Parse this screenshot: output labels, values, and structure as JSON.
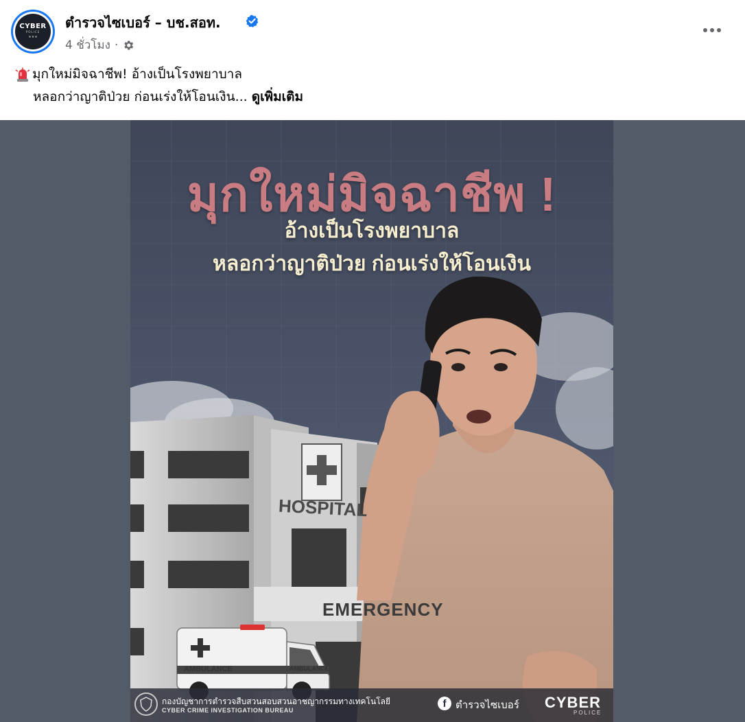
{
  "post": {
    "page_name": "ตำรวจไซเบอร์ – บช.สอท.",
    "timestamp": "4 ชั่วโมง",
    "separator": "·",
    "avatar": {
      "line1": "CYBER",
      "line2": "POLICE",
      "line3": "★★★"
    },
    "icons": {
      "verified": "verified-badge-icon",
      "audience": "gear-icon",
      "more": "more-dots-icon",
      "emoji": "police-siren-icon"
    },
    "colors": {
      "verified": "#1877f2",
      "meta_text": "#65676b",
      "media_bg": "#545b68"
    }
  },
  "caption": {
    "line1": "มุกใหม่มิจฉาชีพ! อ้างเป็นโรงพยาบาล",
    "line2": "หลอกว่าญาติป่วย ก่อนเร่งให้โอนเงิน...",
    "see_more": "ดูเพิ่มเติม"
  },
  "poster": {
    "title": "มุกใหม่มิจฉาชีพ !",
    "subtitle1": "อ้างเป็นโรงพยาบาล",
    "subtitle2": "หลอกว่าญาติป่วย ก่อนเร่งให้โอนเงิน",
    "hospital_sign": "HOSPITAL",
    "emergency_sign": "EMERGENCY",
    "ambulance_label_side": "AMBULANCE",
    "ambulance_label_front": "AMBULANCE",
    "footer": {
      "org_th": "กองบัญชาการตำรวจสืบสวนสอบสวนอาชญากรรมทางเทคโนโลยี",
      "org_en": "CYBER CRIME INVESTIGATION BUREAU",
      "fb_glyph": "f",
      "fb_name": "ตำรวจไซเบอร์",
      "brand": "CYBER",
      "brand_sub": "POLICE"
    }
  }
}
